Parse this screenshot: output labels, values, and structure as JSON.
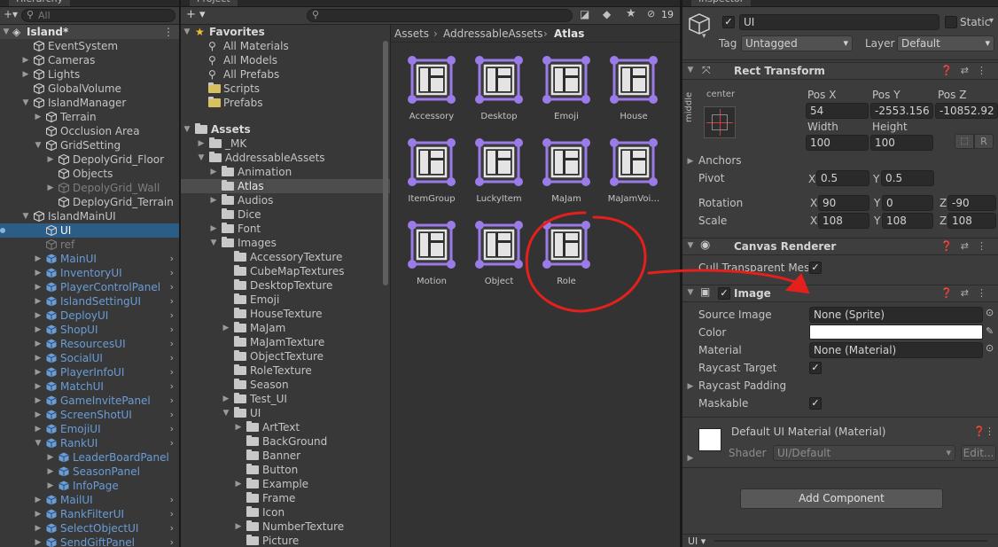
{
  "hierarchy": {
    "tab_label": "Hierarchy",
    "search_placeholder": "All",
    "scene_name": "Island*",
    "items": [
      {
        "label": "EventSystem",
        "depth": 1,
        "arrow": "",
        "kind": "go",
        "style": ""
      },
      {
        "label": "Cameras",
        "depth": 1,
        "arrow": "▶",
        "kind": "go",
        "style": ""
      },
      {
        "label": "Lights",
        "depth": 1,
        "arrow": "▶",
        "kind": "go",
        "style": ""
      },
      {
        "label": "GlobalVolume",
        "depth": 1,
        "arrow": "",
        "kind": "go",
        "style": ""
      },
      {
        "label": "IslandManager",
        "depth": 1,
        "arrow": "▼",
        "kind": "go",
        "style": ""
      },
      {
        "label": "Terrain",
        "depth": 2,
        "arrow": "▶",
        "kind": "go",
        "style": ""
      },
      {
        "label": "Occlusion Area",
        "depth": 2,
        "arrow": "",
        "kind": "go",
        "style": ""
      },
      {
        "label": "GridSetting",
        "depth": 2,
        "arrow": "▼",
        "kind": "go",
        "style": ""
      },
      {
        "label": "DepolyGrid_Floor",
        "depth": 3,
        "arrow": "▶",
        "kind": "go",
        "style": ""
      },
      {
        "label": "Objects",
        "depth": 3,
        "arrow": "",
        "kind": "go",
        "style": ""
      },
      {
        "label": "DepolyGrid_Wall",
        "depth": 3,
        "arrow": "▶",
        "kind": "go",
        "style": "dim"
      },
      {
        "label": "DeployGrid_Terrain",
        "depth": 3,
        "arrow": "",
        "kind": "go",
        "style": ""
      },
      {
        "label": "IslandMainUI",
        "depth": 1,
        "arrow": "▼",
        "kind": "go",
        "style": ""
      },
      {
        "label": "UI",
        "depth": 2,
        "arrow": "",
        "kind": "go",
        "style": "selected"
      },
      {
        "label": "ref",
        "depth": 2,
        "arrow": "",
        "kind": "go",
        "style": "dim"
      },
      {
        "label": "MainUI",
        "depth": 2,
        "arrow": "▶",
        "kind": "prefab",
        "style": "blue"
      },
      {
        "label": "InventoryUI",
        "depth": 2,
        "arrow": "▶",
        "kind": "prefab",
        "style": "blue"
      },
      {
        "label": "PlayerControlPanel",
        "depth": 2,
        "arrow": "▶",
        "kind": "prefab",
        "style": "blue"
      },
      {
        "label": "IslandSettingUI",
        "depth": 2,
        "arrow": "▶",
        "kind": "prefab",
        "style": "blue"
      },
      {
        "label": "DeployUI",
        "depth": 2,
        "arrow": "▶",
        "kind": "prefab",
        "style": "blue"
      },
      {
        "label": "ShopUI",
        "depth": 2,
        "arrow": "▶",
        "kind": "prefab",
        "style": "blue"
      },
      {
        "label": "ResourcesUI",
        "depth": 2,
        "arrow": "▶",
        "kind": "prefab",
        "style": "blue"
      },
      {
        "label": "SocialUI",
        "depth": 2,
        "arrow": "▶",
        "kind": "prefab",
        "style": "blue"
      },
      {
        "label": "PlayerInfoUI",
        "depth": 2,
        "arrow": "▶",
        "kind": "prefab",
        "style": "blue"
      },
      {
        "label": "MatchUI",
        "depth": 2,
        "arrow": "▶",
        "kind": "prefab",
        "style": "blue"
      },
      {
        "label": "GameInvitePanel",
        "depth": 2,
        "arrow": "▶",
        "kind": "prefab",
        "style": "blue"
      },
      {
        "label": "ScreenShotUI",
        "depth": 2,
        "arrow": "▶",
        "kind": "prefab",
        "style": "blue"
      },
      {
        "label": "EmojiUI",
        "depth": 2,
        "arrow": "▶",
        "kind": "prefab",
        "style": "blue"
      },
      {
        "label": "RankUI",
        "depth": 2,
        "arrow": "▼",
        "kind": "prefab",
        "style": "blue"
      },
      {
        "label": "LeaderBoardPanel",
        "depth": 3,
        "arrow": "▶",
        "kind": "prefab",
        "style": "blue"
      },
      {
        "label": "SeasonPanel",
        "depth": 3,
        "arrow": "▶",
        "kind": "prefab",
        "style": "blue"
      },
      {
        "label": "InfoPage",
        "depth": 3,
        "arrow": "▶",
        "kind": "prefab",
        "style": "blue"
      },
      {
        "label": "MailUI",
        "depth": 2,
        "arrow": "▶",
        "kind": "prefab",
        "style": "blue"
      },
      {
        "label": "RankFilterUI",
        "depth": 2,
        "arrow": "▶",
        "kind": "prefab",
        "style": "blue"
      },
      {
        "label": "SelectObjectUI",
        "depth": 2,
        "arrow": "▶",
        "kind": "prefab",
        "style": "blue"
      },
      {
        "label": "SendGiftPanel",
        "depth": 2,
        "arrow": "▶",
        "kind": "prefab",
        "style": "blue"
      }
    ]
  },
  "project": {
    "tab_label": "Project",
    "add_label": "+ ▾",
    "hidden_count": "19",
    "favorites_label": "Favorites",
    "favorites": [
      {
        "label": "All Materials",
        "kind": "search"
      },
      {
        "label": "All Models",
        "kind": "search"
      },
      {
        "label": "All Prefabs",
        "kind": "search"
      },
      {
        "label": "Scripts",
        "kind": "folder"
      },
      {
        "label": "Prefabs",
        "kind": "folder"
      }
    ],
    "assets_label": "Assets",
    "tree": [
      {
        "label": "_MK",
        "depth": 1,
        "arrow": "▶",
        "selected": false
      },
      {
        "label": "AddressableAssets",
        "depth": 1,
        "arrow": "▼",
        "selected": false
      },
      {
        "label": "Animation",
        "depth": 2,
        "arrow": "▶",
        "selected": false
      },
      {
        "label": "Atlas",
        "depth": 2,
        "arrow": "",
        "selected": true
      },
      {
        "label": "Audios",
        "depth": 2,
        "arrow": "▶",
        "selected": false
      },
      {
        "label": "Dice",
        "depth": 2,
        "arrow": "",
        "selected": false
      },
      {
        "label": "Font",
        "depth": 2,
        "arrow": "▶",
        "selected": false
      },
      {
        "label": "Images",
        "depth": 2,
        "arrow": "▼",
        "selected": false
      },
      {
        "label": "AccessoryTexture",
        "depth": 3,
        "arrow": "",
        "selected": false
      },
      {
        "label": "CubeMapTextures",
        "depth": 3,
        "arrow": "",
        "selected": false
      },
      {
        "label": "DesktopTexture",
        "depth": 3,
        "arrow": "",
        "selected": false
      },
      {
        "label": "Emoji",
        "depth": 3,
        "arrow": "",
        "selected": false
      },
      {
        "label": "HouseTexture",
        "depth": 3,
        "arrow": "",
        "selected": false
      },
      {
        "label": "MaJam",
        "depth": 3,
        "arrow": "▶",
        "selected": false
      },
      {
        "label": "MaJamTexture",
        "depth": 3,
        "arrow": "",
        "selected": false
      },
      {
        "label": "ObjectTexture",
        "depth": 3,
        "arrow": "",
        "selected": false
      },
      {
        "label": "RoleTexture",
        "depth": 3,
        "arrow": "",
        "selected": false
      },
      {
        "label": "Season",
        "depth": 3,
        "arrow": "",
        "selected": false
      },
      {
        "label": "Test_UI",
        "depth": 3,
        "arrow": "▶",
        "selected": false
      },
      {
        "label": "UI",
        "depth": 3,
        "arrow": "▼",
        "selected": false
      },
      {
        "label": "ArtText",
        "depth": 4,
        "arrow": "▶",
        "selected": false
      },
      {
        "label": "BackGround",
        "depth": 4,
        "arrow": "",
        "selected": false
      },
      {
        "label": "Banner",
        "depth": 4,
        "arrow": "",
        "selected": false
      },
      {
        "label": "Button",
        "depth": 4,
        "arrow": "",
        "selected": false
      },
      {
        "label": "Example",
        "depth": 4,
        "arrow": "▶",
        "selected": false
      },
      {
        "label": "Frame",
        "depth": 4,
        "arrow": "",
        "selected": false
      },
      {
        "label": "Icon",
        "depth": 4,
        "arrow": "",
        "selected": false
      },
      {
        "label": "NumberTexture",
        "depth": 4,
        "arrow": "▶",
        "selected": false
      },
      {
        "label": "Picture",
        "depth": 4,
        "arrow": "",
        "selected": false
      }
    ],
    "breadcrumb": [
      "Assets",
      "AddressableAssets",
      "Atlas"
    ],
    "assets": [
      "Accessory",
      "Desktop",
      "Emoji",
      "House",
      "ItemGroup",
      "LuckyItem",
      "MaJam",
      "MaJamVoi…",
      "Motion",
      "Object",
      "Role"
    ]
  },
  "inspector": {
    "tab_label": "Inspector",
    "object_name": "UI",
    "static_label": "Static",
    "tag_label": "Tag",
    "tag_value": "Untagged",
    "layer_label": "Layer",
    "layer_value": "Default",
    "rect_transform": {
      "title": "Rect Transform",
      "anchor_preset_top": "center",
      "anchor_preset_side": "middle",
      "pos_x_label": "Pos X",
      "pos_x": "54",
      "pos_y_label": "Pos Y",
      "pos_y": "-2553.156",
      "pos_z_label": "Pos Z",
      "pos_z": "-10852.92",
      "width_label": "Width",
      "width": "100",
      "height_label": "Height",
      "height": "100",
      "r_button": "R",
      "anchors_label": "Anchors",
      "pivot_label": "Pivot",
      "pivot_x": "0.5",
      "pivot_y": "0.5",
      "rotation_label": "Rotation",
      "rot_x": "90",
      "rot_y": "0",
      "rot_z": "-90",
      "scale_label": "Scale",
      "scale_x": "108",
      "scale_y": "108",
      "scale_z": "108",
      "x": "X",
      "y": "Y",
      "z": "Z"
    },
    "canvas_renderer": {
      "title": "Canvas Renderer",
      "cull_label": "Cull Transparent Mesh"
    },
    "image": {
      "title": "Image",
      "source_image_label": "Source Image",
      "source_image_value": "None (Sprite)",
      "color_label": "Color",
      "color_value": "#ffffff",
      "material_label": "Material",
      "material_value": "None (Material)",
      "raycast_target_label": "Raycast Target",
      "raycast_padding_label": "Raycast Padding",
      "maskable_label": "Maskable"
    },
    "material_preview": {
      "title": "Default UI Material (Material)",
      "shader_label": "Shader",
      "shader_value": "UI/Default",
      "edit_label": "Edit..."
    },
    "add_component_label": "Add Component",
    "footer_label": "UI ▾"
  },
  "colors": {
    "selection": "#2c5d87",
    "accent_purple": "#9b7be8",
    "annotation_red": "#e4201c",
    "prefab_blue": "#6a9cd6"
  }
}
